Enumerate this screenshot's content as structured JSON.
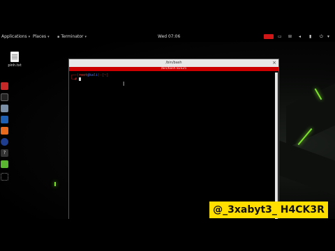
{
  "topbar": {
    "applications": "Applications",
    "places": "Places",
    "app_name": "Terminator",
    "clock": "Wed 07:06"
  },
  "desktop": {
    "file_name": "pinh.txt"
  },
  "terminal": {
    "window_title": "/bin/bash",
    "banner_title": "/bin/bash 82x25",
    "prompt_line1_open": "┌──(",
    "prompt_user": "root",
    "prompt_host": "@kali",
    "prompt_line1_close": ")-[~]",
    "prompt_line2": "└─#"
  },
  "overlay": {
    "handle": "@_3xabyt3_ H4CK3R"
  },
  "colors": {
    "accent_green": "#7ce22a",
    "terminal_banner": "#cc0000",
    "handle_bg": "#ffdf00"
  }
}
